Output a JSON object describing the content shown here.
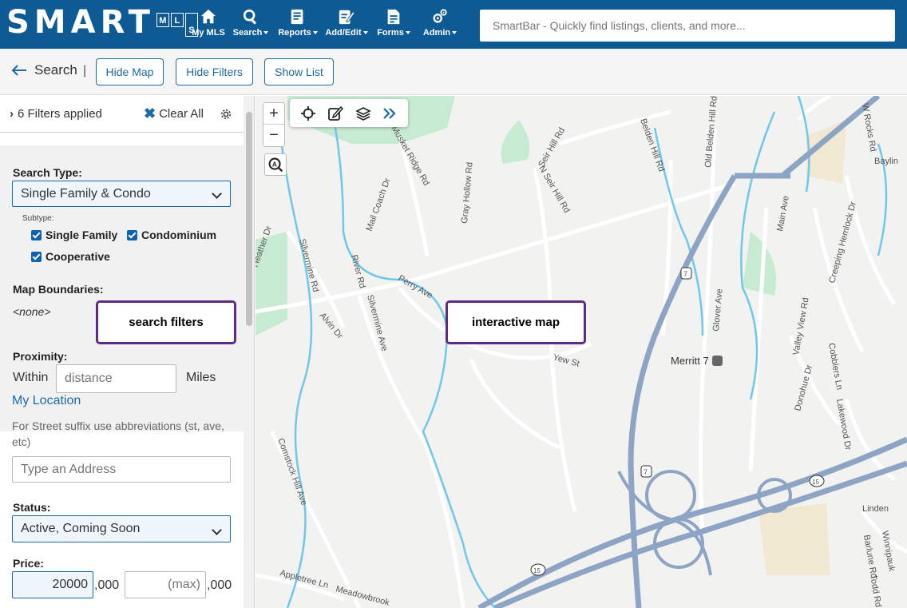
{
  "header": {
    "logo_text": "SMART",
    "logo_boxes": [
      "M",
      "L",
      "S"
    ],
    "nav": [
      {
        "label": "My MLS",
        "icon": "home-icon"
      },
      {
        "label": "Search",
        "icon": "search-icon",
        "dropdown": true
      },
      {
        "label": "Reports",
        "icon": "report-icon",
        "dropdown": true
      },
      {
        "label": "Add/Edit",
        "icon": "edit-icon",
        "dropdown": true
      },
      {
        "label": "Forms",
        "icon": "forms-icon",
        "dropdown": true
      },
      {
        "label": "Admin",
        "icon": "gears-icon",
        "dropdown": true
      }
    ],
    "smartbar_placeholder": "SmartBar - Quickly find listings, clients, and more..."
  },
  "toolbar": {
    "back_label": "Search",
    "separator": "|",
    "buttons": [
      "Hide Map",
      "Hide Filters",
      "Show List"
    ]
  },
  "filters": {
    "applied_label": "6 Filters applied",
    "clear_all_label": "Clear All",
    "search_type_label": "Search Type:",
    "search_type_value": "Single Family & Condo",
    "subtype_label": "Subtype:",
    "subtypes": [
      {
        "label": "Single Family",
        "checked": true
      },
      {
        "label": "Condominium",
        "checked": true
      },
      {
        "label": "Cooperative",
        "checked": true
      }
    ],
    "map_boundaries_label": "Map Boundaries:",
    "map_boundaries_value": "<none>",
    "callout_filters": "search filters",
    "proximity_label": "Proximity:",
    "within_label": "Within",
    "distance_placeholder": "distance",
    "miles_label": "Miles",
    "my_location_label": "My Location",
    "street_hint": "For Street suffix use abbreviations (st, ave, etc)",
    "address_placeholder": "Type an Address",
    "status_label": "Status:",
    "status_value": "Active, Coming Soon",
    "price_label": "Price:",
    "price_min": "20000",
    "price_min_suffix": ",000",
    "price_max_placeholder": "(max)",
    "price_max_suffix": ",000"
  },
  "map": {
    "callout_map": "interactive map",
    "place_label": "Merritt 7",
    "route_shields": [
      "7",
      "7",
      "15",
      "15"
    ],
    "street_labels": [
      "Musket Ridge Rd",
      "Seir Hill Rd",
      "N Seir Hill Rd",
      "Belden Hill Rd",
      "Old Belden Hill Rd",
      "Main Ave",
      "W Rocks Rd",
      "Mail Coach Dr",
      "Gray Hollow Rd",
      "Silvermine Rd",
      "River Rd",
      "Perry Ave",
      "Silvermine Ave",
      "Alvin Dr",
      "Yew St",
      "Comstock Hill Ave",
      "Glover Ave",
      "Creeping Hemlock Dr",
      "Valley View Rd",
      "Cobblers Ln",
      "Donohue Dr",
      "Lakewood Dr",
      "Appletree Ln",
      "Meadowbrook",
      "Baylin",
      "Linden",
      "Winnipauk",
      "Barlune Rd",
      "Todd Rd",
      "Heather Dr"
    ],
    "tools": [
      "crosshair-icon",
      "draw-icon",
      "layers-icon",
      "expand-icon"
    ]
  },
  "colors": {
    "header_bg": "#0e5a94",
    "accent": "#1b6aa6",
    "callout_border": "#5b2b86",
    "water": "#6fc8e8",
    "highway": "#8ea4c4",
    "park": "#c7ebd2"
  }
}
